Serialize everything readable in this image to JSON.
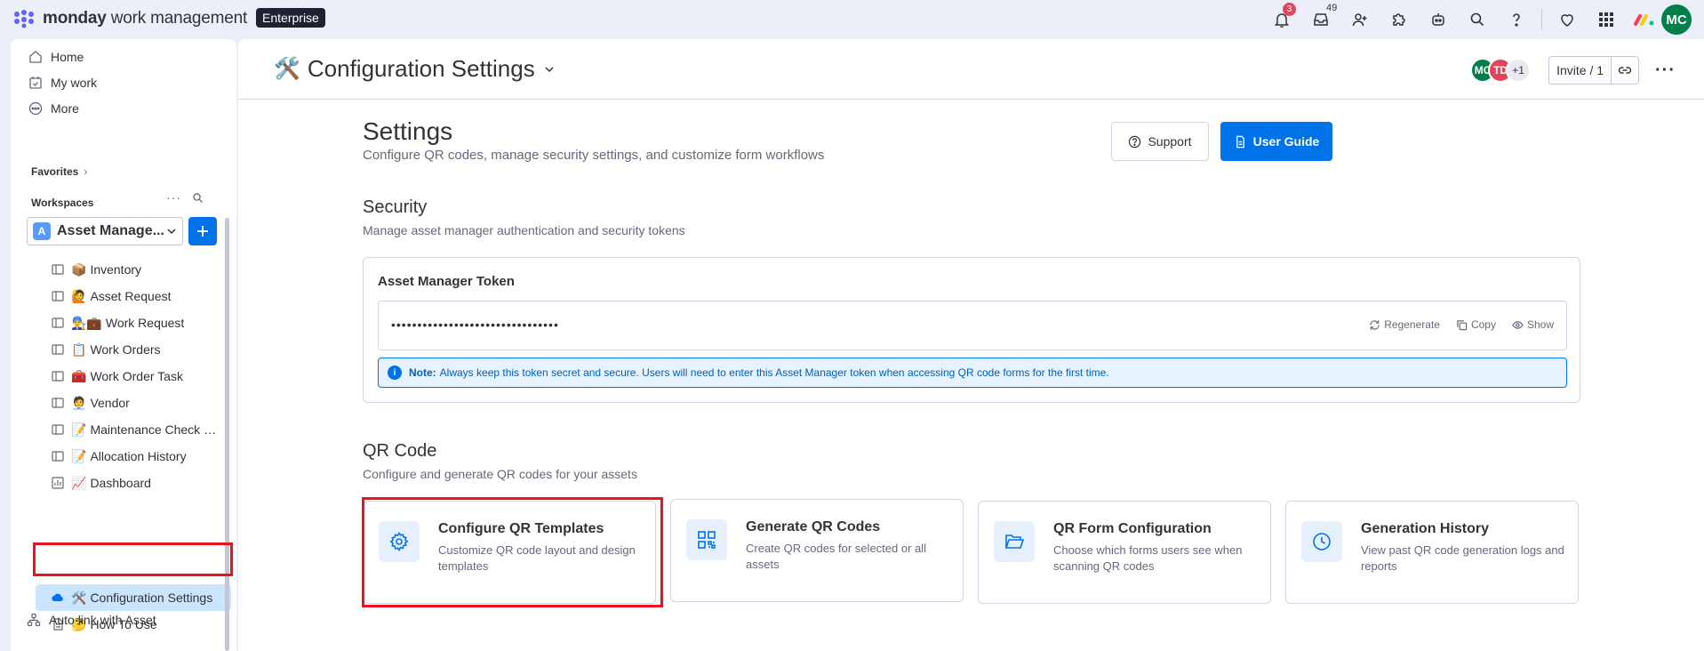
{
  "app": {
    "brand_bold": "monday",
    "brand_rest": " work management",
    "plan_badge": "Enterprise"
  },
  "topbar": {
    "notifications_count": "3",
    "inbox_count": "49",
    "user_initials": "MC"
  },
  "sidebar": {
    "home": "Home",
    "my_work": "My work",
    "more": "More",
    "favorites": "Favorites",
    "workspaces": "Workspaces",
    "workspace_letter": "A",
    "workspace_name": "Asset Manage...",
    "boards": [
      {
        "emoji": "📦",
        "label": "Inventory"
      },
      {
        "emoji": "🙋",
        "label": "Asset Request"
      },
      {
        "emoji": "👨‍🔧💼",
        "label": "Work Request"
      },
      {
        "emoji": "📋",
        "label": "Work Orders"
      },
      {
        "emoji": "🧰",
        "label": "Work Order Task"
      },
      {
        "emoji": "🧑‍💼",
        "label": "Vendor"
      },
      {
        "emoji": "📝",
        "label": "Maintenance Check Li..."
      },
      {
        "emoji": "📝",
        "label": "Allocation History"
      },
      {
        "emoji": "📈",
        "label": "Dashboard"
      },
      {
        "emoji": "🛠️",
        "label": "Configuration Settings"
      },
      {
        "emoji": "🤔",
        "label": "How To Use"
      }
    ],
    "auto_link": "Auto link with Asset"
  },
  "header": {
    "board_emoji": "🛠️",
    "board_title": "Configuration Settings",
    "avatars": [
      "MC",
      "TD",
      "+1"
    ],
    "invite_label": "Invite / 1"
  },
  "settings": {
    "title": "Settings",
    "subtitle": "Configure QR codes, manage security settings, and customize form workflows",
    "support_label": "Support",
    "guide_label": "User Guide"
  },
  "security": {
    "title": "Security",
    "subtitle": "Manage asset manager authentication and security tokens",
    "token_label": "Asset Manager Token",
    "token_masked": "••••••••••••••••••••••••••••••••",
    "regenerate": "Regenerate",
    "copy": "Copy",
    "show": "Show",
    "note_bold": "Note:",
    "note_text": "Always keep this token secret and secure. Users will need to enter this Asset Manager token when accessing QR code forms for the first time."
  },
  "qr": {
    "title": "QR Code",
    "subtitle": "Configure and generate QR codes for your assets",
    "cards": [
      {
        "title": "Configure QR Templates",
        "desc": "Customize QR code layout and design templates",
        "icon": "gear-icon"
      },
      {
        "title": "Generate QR Codes",
        "desc": "Create QR codes for selected or all assets",
        "icon": "qr-code-icon"
      },
      {
        "title": "QR Form Configuration",
        "desc": "Choose which forms users see when scanning QR codes",
        "icon": "folder-open-icon"
      },
      {
        "title": "Generation History",
        "desc": "View past QR code generation logs and reports",
        "icon": "clock-icon"
      }
    ]
  },
  "colors": {
    "accent": "#0073ea",
    "highlight": "#e5141f",
    "avatar_mc": "#037f4c",
    "avatar_td": "#e2445c"
  }
}
